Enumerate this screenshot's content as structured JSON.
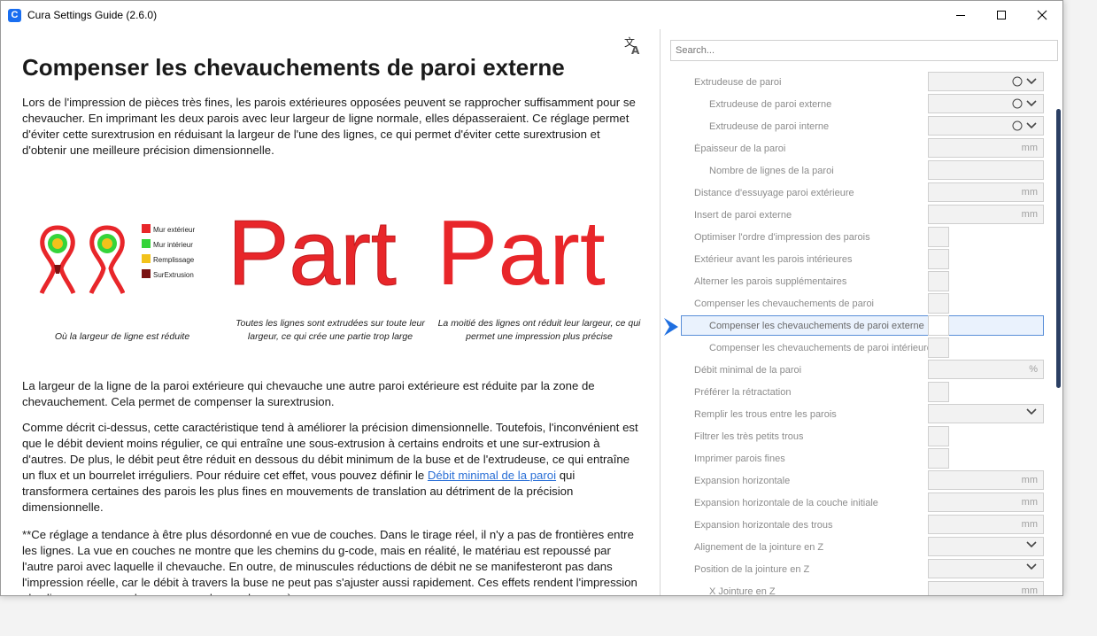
{
  "window": {
    "title": "Cura Settings Guide (2.6.0)",
    "icon_letter": "C"
  },
  "article": {
    "title": "Compenser les chevauchements de paroi externe",
    "intro": "Lors de l'impression de pièces très fines, les parois extérieures opposées peuvent se rapprocher suffisamment pour se chevaucher. En imprimant les deux parois avec leur largeur de ligne normale, elles dépasseraient. Ce réglage permet d'éviter cette surextrusion en réduisant la largeur de l'une des lignes, ce qui permet d'éviter cette surextrusion et d'obtenir une meilleure précision dimensionnelle.",
    "figure": {
      "legend": [
        "Mur extérieur",
        "Mur intérieur",
        "Remplissage",
        "SurExtrusion"
      ],
      "legend_colors": [
        "#e8262a",
        "#35d43a",
        "#f2c21b",
        "#7a1212"
      ],
      "part_word": "Part",
      "caption_1": "Où la largeur de ligne est réduite",
      "caption_2": "Toutes les lignes sont extrudées sur toute leur largeur, ce qui crée une partie trop large",
      "caption_3": "La moitié des lignes ont réduit leur largeur, ce qui permet une impression plus précise"
    },
    "p2": "La largeur de la ligne de la paroi extérieure qui chevauche une autre paroi extérieure est réduite par la zone de chevauchement. Cela permet de compenser la surextrusion.",
    "p3_before": "Comme décrit ci-dessus, cette caractéristique tend à améliorer la précision dimensionnelle. Toutefois, l'inconvénient est que le débit devient moins régulier, ce qui entraîne une sous-extrusion à certains endroits et une sur-extrusion à d'autres. De plus, le débit peut être réduit en dessous du débit minimum de la buse et de l'extrudeuse, ce qui entraîne un flux et un bourrelet irréguliers. Pour réduire cet effet, vous pouvez définir le ",
    "p3_link": "Débit minimal de la paroi",
    "p3_after": " qui transformera certaines des parois les plus fines en mouvements de translation au détriment de la précision dimensionnelle.",
    "p4": "**Ce réglage a tendance à être plus désordonné en vue de couches. Dans le tirage réel, il n'y a pas de frontières entre les lignes. La vue en couches ne montre que les chemins du g-code, mais en réalité, le matériau est repoussé par l'autre paroi avec laquelle il chevauche. En outre, de minuscules réductions de débit ne se manifesteront pas dans l'impression réelle, car le débit à travers la buse ne peut pas s'ajuster aussi rapidement. Ces effets rendent l'impression plus lisse que ce que la vue en couches ne le suggère."
  },
  "settings": {
    "search_placeholder": "Search...",
    "items": [
      {
        "label": "Extrudeuse de paroi",
        "indent": 0,
        "control": "extruder"
      },
      {
        "label": "Extrudeuse de paroi externe",
        "indent": 1,
        "control": "extruder"
      },
      {
        "label": "Extrudeuse de paroi interne",
        "indent": 1,
        "control": "extruder"
      },
      {
        "label": "Épaisseur de la paroi",
        "indent": 0,
        "control": "field",
        "unit": "mm"
      },
      {
        "label": "Nombre de lignes de la paroi",
        "indent": 1,
        "control": "field",
        "unit": ""
      },
      {
        "label": "Distance d'essuyage paroi extérieure",
        "indent": 0,
        "control": "field",
        "unit": "mm"
      },
      {
        "label": "Insert de paroi externe",
        "indent": 0,
        "control": "field",
        "unit": "mm"
      },
      {
        "label": "Optimiser l'ordre d'impression des parois",
        "indent": 0,
        "control": "check"
      },
      {
        "label": "Extérieur avant les parois intérieures",
        "indent": 0,
        "control": "check"
      },
      {
        "label": "Alterner les parois supplémentaires",
        "indent": 0,
        "control": "check"
      },
      {
        "label": "Compenser les chevauchements de paroi",
        "indent": 0,
        "control": "check"
      },
      {
        "label": "Compenser les chevauchements de paroi externe",
        "indent": 1,
        "control": "check",
        "selected": true
      },
      {
        "label": "Compenser les chevauchements de paroi intérieure",
        "indent": 1,
        "control": "check"
      },
      {
        "label": "Débit minimal de la paroi",
        "indent": 0,
        "control": "field",
        "unit": "%"
      },
      {
        "label": "Préférer la rétractation",
        "indent": 0,
        "control": "check"
      },
      {
        "label": "Remplir les trous entre les parois",
        "indent": 0,
        "control": "select"
      },
      {
        "label": "Filtrer les très petits trous",
        "indent": 0,
        "control": "check"
      },
      {
        "label": "Imprimer parois fines",
        "indent": 0,
        "control": "check"
      },
      {
        "label": "Expansion horizontale",
        "indent": 0,
        "control": "field",
        "unit": "mm"
      },
      {
        "label": "Expansion horizontale de la couche initiale",
        "indent": 0,
        "control": "field",
        "unit": "mm"
      },
      {
        "label": "Expansion horizontale des trous",
        "indent": 0,
        "control": "field",
        "unit": "mm"
      },
      {
        "label": "Alignement de la jointure en Z",
        "indent": 0,
        "control": "select"
      },
      {
        "label": "Position de la jointure en Z",
        "indent": 0,
        "control": "select"
      },
      {
        "label": "X Jointure en Z",
        "indent": 1,
        "control": "field",
        "unit": "mm"
      }
    ]
  }
}
